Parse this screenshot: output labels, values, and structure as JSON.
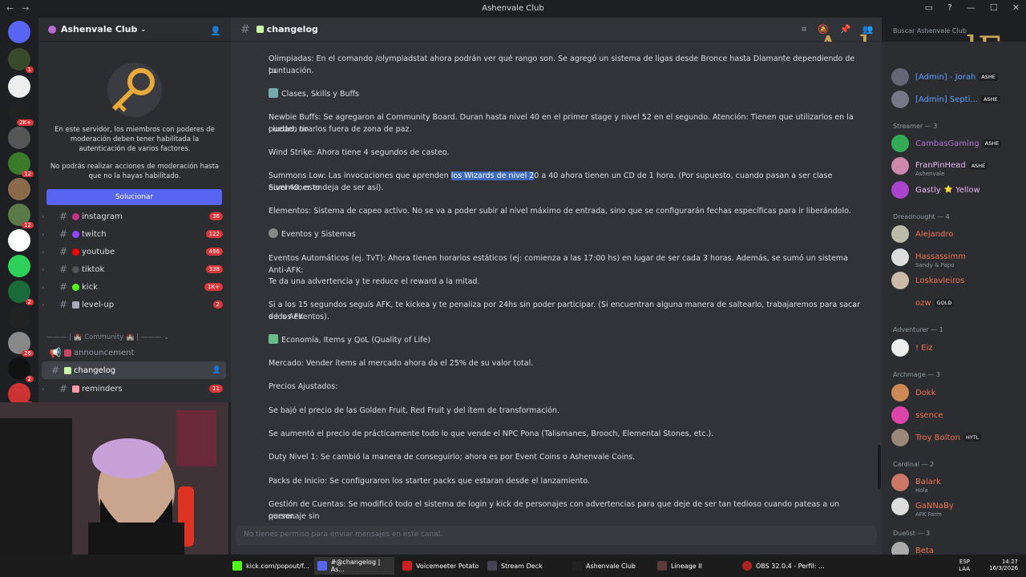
{
  "window": {
    "title": "Ashenvale Club"
  },
  "server": {
    "name": "Ashenvale Club"
  },
  "moderation_notice": {
    "text1": "En este servidor, los miembros con poderes de moderación deben tener habilitada la autenticación de varios factores.",
    "text2": "No podrás realizar acciones de moderación hasta que no la hayas habilitado.",
    "button": "Solucionar"
  },
  "guild_badges": [
    "1",
    "2K+",
    "12",
    "12",
    "2",
    "26",
    "2",
    "4"
  ],
  "channels": [
    {
      "name": "instagram",
      "count": "36"
    },
    {
      "name": "twitch",
      "count": "122"
    },
    {
      "name": "youtube",
      "count": "496"
    },
    {
      "name": "tiktok",
      "count": "338"
    },
    {
      "name": "kick",
      "count": "1K+"
    },
    {
      "name": "level-up",
      "count": "2"
    }
  ],
  "category": "Community",
  "channels2": [
    {
      "name": "announcement"
    },
    {
      "name": "changelog"
    },
    {
      "name": "reminders",
      "count": "11"
    }
  ],
  "header": {
    "channel": "changelog",
    "search_placeholder": "Buscar Ashenvale Club",
    "logo_text": "AsheпvalE"
  },
  "messages": {
    "olimpiadas": "Olimpiadas: En el comando /olympiadstat ahora podrán ver qué rango son. Se agregó un sistema de ligas desde Bronce hasta Diamante dependiendo de tu",
    "puntuacion": "puntuación.",
    "clases": "Clases, Skills y Buffs",
    "newbie": "Newbie Buffs: Se agregaron al Community Board. Duran hasta nivel 40 en el primer stage y nivel 52 en el segundo. Atención: Tienen que utilizarlos en la ciudad, no",
    "newbie2": "pueden tirarlos fuera de zona de paz.",
    "wind": "Wind Strike: Ahora tiene 4 segundos de casteo.",
    "summons_a": "Summons Low: Las invocaciones que aprenden",
    "summons_sel": "los Wizards de nivel 2",
    "summons_b": "0 a 40 ahora tienen un CD de 1 hora. (Por supuesto, cuando pasan a ser clase Summoner en",
    "summons2": "nivel 40, esto deja de ser así).",
    "elementos": "Elementos: Sistema de capeo activo. No se va a poder subir al nivel máximo de entrada, sino que se configurarán fechas específicas para ir liberándolo.",
    "eventos": "Eventos y Sistemas",
    "automaticos": "Eventos Automáticos (ej. TvT): Ahora tienen horarios estáticos (ej: comienza a las 17:00 hs) en lugar de ser cada 3 horas. Además, se sumó un sistema Anti-AFK:",
    "advertencia": "Te da una advertencia y te reduce el reward a la mitad.",
    "afk": "Si a los 15 segundos seguís AFK, te kickea y te penaliza por 24hs sin poder participar. (Si encuentran alguna manera de saltearlo, trabajaremos para sacar a los AFK",
    "afk2": "de los eventos).",
    "economia": "Economía, Items y QoL (Quality of Life)",
    "mercado": "Mercado: Vender ítems al mercado ahora da el 25% de su valor total.",
    "precios": "Precios Ajustados:",
    "bajo": "Se bajó el precio de las Golden Fruit, Red Fruit y del ítem de transformación.",
    "aumento": "Se aumentó el precio de prácticamente todo lo que vende el NPC Pona (Talismanes, Brooch, Elemental Stones, etc.).",
    "duty": "Duty Nivel 1: Se cambió la manera de conseguirlo; ahora es por Event Coins o Ashenvale Coins.",
    "packs": "Packs de Inicio: Se configuraron los starter packs que estaran desde el lanzamiento.",
    "gestion": "Gestión de Cuentas: Se modificó todo el sistema de login y kick de personajes con advertencias para que deje de ser tan tedioso cuando pateas a un personaje sin",
    "gestion2": "querer."
  },
  "composer_placeholder": "No tienes permiso para enviar mensajes en este canal.",
  "members": {
    "top": [
      {
        "name": "[Admin] - Jorah",
        "tag": "ASHE",
        "color": "#5aa0ff"
      },
      {
        "name": "[Admin] Septi...",
        "tag": "ASHE",
        "color": "#5aa0ff"
      }
    ],
    "streamer_label": "Streamer — 3",
    "streamers": [
      {
        "name": "CambasGaming",
        "tag": "ASHE",
        "color": "#b46ad8",
        "sub": ""
      },
      {
        "name": "FranPinHead",
        "tag": "ASHE",
        "color": "#e8b4f5",
        "sub": "Ashenvale"
      },
      {
        "name": "Gastly",
        "tag": "Yellow",
        "color": "#e8b4f5",
        "sub": ""
      }
    ],
    "dread_label": "Dreadnought — 4",
    "dread": [
      {
        "name": "Alejandro",
        "color": "#f0714f",
        "sub": ""
      },
      {
        "name": "Hassassimm",
        "color": "#f0714f",
        "sub": "Sandy & Papo"
      },
      {
        "name": "Loskavleiros",
        "color": "#f0714f",
        "sub": ""
      },
      {
        "name": "ozw",
        "tag": "GOLD",
        "color": "#f0714f",
        "sub": ""
      }
    ],
    "adv_label": "Adventurer — 1",
    "adv": [
      {
        "name": "! Eiz",
        "color": "#f0714f"
      }
    ],
    "arch_label": "Archmage — 3",
    "arch": [
      {
        "name": "Dokk",
        "color": "#f0714f"
      },
      {
        "name": "ssence",
        "color": "#f0714f"
      },
      {
        "name": "Troy Bolton",
        "tag": "HYTL",
        "color": "#f0714f"
      }
    ],
    "card_label": "Cardinal — 2",
    "card": [
      {
        "name": "Balark",
        "color": "#f0714f",
        "sub": "Hola"
      },
      {
        "name": "GaNNaBy",
        "color": "#f0714f",
        "sub": "AFK Farm"
      }
    ],
    "duel_label": "Duelist — 3",
    "duel": [
      {
        "name": "Beta",
        "color": "#f0714f"
      }
    ]
  },
  "taskbar": {
    "items": [
      "kick.com/popout/f...",
      "#@changelog | As...",
      "Voicemeeter Potato",
      "Stream Deck",
      "Ashenvale Club",
      "Lineage II",
      "OBS 32.0.4 - Perfil: ..."
    ],
    "lang": "ESP",
    "lang2": "LAA",
    "time": "14:27",
    "date": "16/3/2026"
  }
}
